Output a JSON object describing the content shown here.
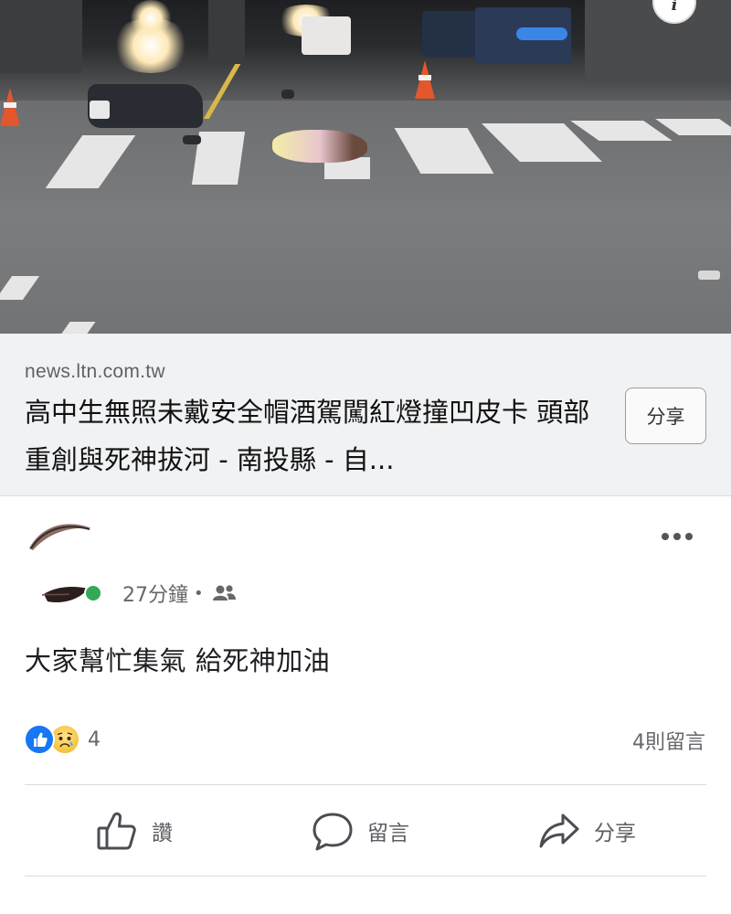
{
  "preview": {
    "domain": "news.ltn.com.tw",
    "title": "高中生無照未戴安全帽酒駕闖紅燈撞凹皮卡 頭部重創與死神拔河 - 南投縣 - 自...",
    "share_label": "分享",
    "info_icon": "info-icon"
  },
  "post": {
    "time": "27分鐘",
    "audience_icon": "friends-icon",
    "text": "大家幫忙集氣 給死神加油",
    "reaction_icons": [
      "like-reaction-icon",
      "sad-reaction-icon"
    ],
    "reaction_count": "4",
    "comment_count": "4則留言"
  },
  "actions": {
    "like": "讚",
    "comment": "留言",
    "share": "分享"
  },
  "colors": {
    "online": "#34a853",
    "like_blue": "#1877f2",
    "link_box_bg": "#f1f2f4"
  }
}
